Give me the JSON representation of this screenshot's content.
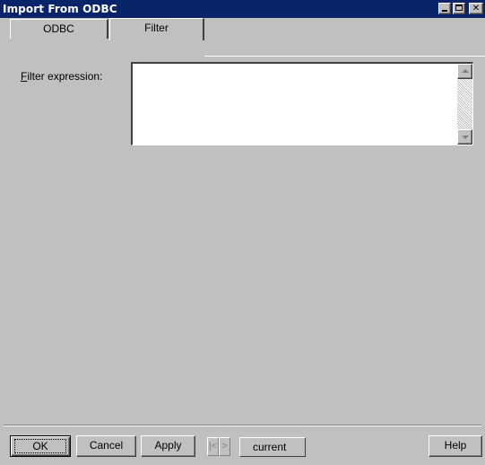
{
  "window": {
    "title": "Import From ODBC"
  },
  "tabs": [
    {
      "label": "ODBC"
    },
    {
      "label": "Filter",
      "active": true
    }
  ],
  "filter": {
    "label_accel": "F",
    "label_rest": "ilter expression:",
    "value": ""
  },
  "buttons": {
    "ok": "OK",
    "cancel": "Cancel",
    "apply": "Apply",
    "help": "Help"
  },
  "navigator": {
    "first": "|<",
    "next": ">",
    "current": "current"
  },
  "colors": {
    "titlebar": "#0a246a",
    "face": "#c0c0c0"
  },
  "icons": [
    "minimize-icon",
    "maximize-icon",
    "close-icon",
    "scroll-up-icon",
    "scroll-down-icon"
  ]
}
